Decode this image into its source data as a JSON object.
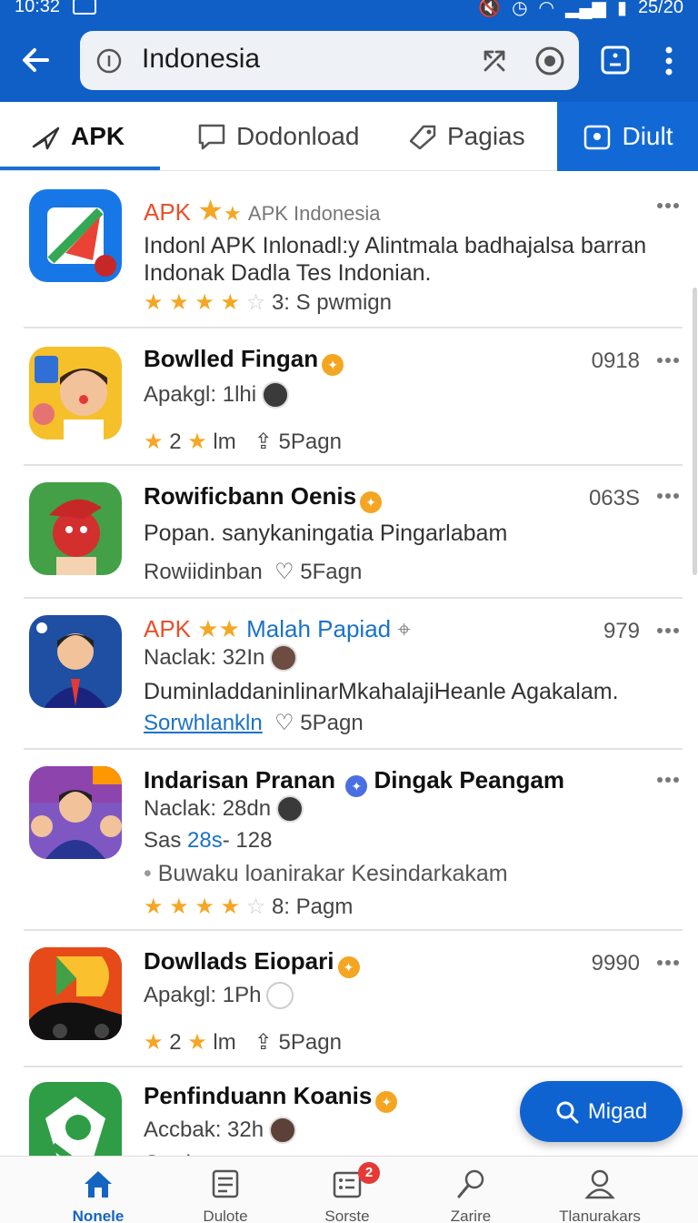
{
  "status": {
    "time": "10:32",
    "right": "25/20"
  },
  "browser": {
    "url_text": "Indonesia"
  },
  "tabs": [
    {
      "label": "APK"
    },
    {
      "label": "Dodonload"
    },
    {
      "label": "Pagias"
    },
    {
      "label": "Diult"
    }
  ],
  "items": [
    {
      "apk": "APK",
      "subtitle": "APK Indonesia",
      "desc1": "Indonl APK Inlonadl:y Alintmala badhajalsa barran",
      "desc2": "Indonak Dadla Tes Indonian.",
      "rating_text": "3: S pwmign",
      "stars": 4
    },
    {
      "title": "Bowlled Fingan",
      "count": "0918",
      "line1": "Apakgl: 1lhi",
      "stat": "2",
      "unit": "lm",
      "pages": "5Pagn"
    },
    {
      "title": "Rowificbann Oenis",
      "count": "063S",
      "desc": "Popan. sanykaningatia Pingarlabam",
      "line2": "Rowiidinban",
      "pages": "5Fagn"
    },
    {
      "apk": "APK",
      "title_blue": "Malah Papiad",
      "count": "979",
      "line1": "Naclak: 32In",
      "desc": "DuminladdaninlinarMkahalajiHeanle Agakalam.",
      "link": "Sorwhlankln",
      "pages": "5Pagn"
    },
    {
      "title_a": "Indarisan Pranan",
      "title_b": "Dingak Peangam",
      "line1": "Naclak: 28dn",
      "line2_a": "Sas",
      "line2_b": "28s",
      "line2_c": "- 128",
      "bullet": "Buwaku loanirakar Kesindarkakam",
      "rating_text": "8: Pagm",
      "stars": 4
    },
    {
      "title": "Dowllads Eiopari",
      "count": "9990",
      "line1": "Apakgl: 1Ph",
      "stat": "2",
      "unit": "lm",
      "pages": "5Pagn"
    },
    {
      "title": "Penfinduann Koanis",
      "line1": "Accbak: 32h",
      "line2": "Corrl"
    }
  ],
  "fab": {
    "label": "Migad"
  },
  "nav": [
    {
      "label": "Nonele"
    },
    {
      "label": "Dulote"
    },
    {
      "label": "Sorste",
      "badge": "2"
    },
    {
      "label": "Zarire"
    },
    {
      "label": "Tlanurakars"
    }
  ]
}
